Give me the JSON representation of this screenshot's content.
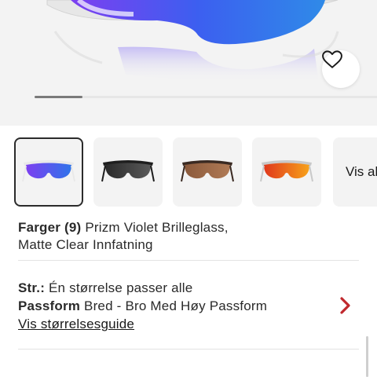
{
  "product": {
    "favorite_icon": "heart-icon",
    "gallery_progress": 0.14
  },
  "thumbnails": {
    "variants": [
      {
        "name": "prizm-violet",
        "lens_colors": [
          "#7d3ff0",
          "#2f74ea"
        ],
        "frame_color": "#e9e9e9"
      },
      {
        "name": "prizm-black",
        "lens_colors": [
          "#2a2a2a",
          "#5a5a5a"
        ],
        "frame_color": "#1e1e1e"
      },
      {
        "name": "prizm-bronze",
        "lens_colors": [
          "#8b5a3c",
          "#b07a55"
        ],
        "frame_color": "#3a2a22"
      },
      {
        "name": "prizm-ruby",
        "lens_colors": [
          "#e0381c",
          "#f7a21b"
        ],
        "frame_color": "#c9c9c9"
      }
    ],
    "more_label": "Vis al"
  },
  "color": {
    "label": "Farger (9)",
    "value_line1": "Prizm Violet Brilleglass,",
    "value_line2": "Matte Clear Innfatning"
  },
  "size": {
    "label": "Str.:",
    "value": "Én størrelse passer alle",
    "fit_label": "Passform",
    "fit_value": "Bred - Bro Med Høy Passform",
    "guide_link": "Vis størrelsesguide",
    "chevron_icon": "chevron-right-icon",
    "accent": "#c0282d"
  }
}
